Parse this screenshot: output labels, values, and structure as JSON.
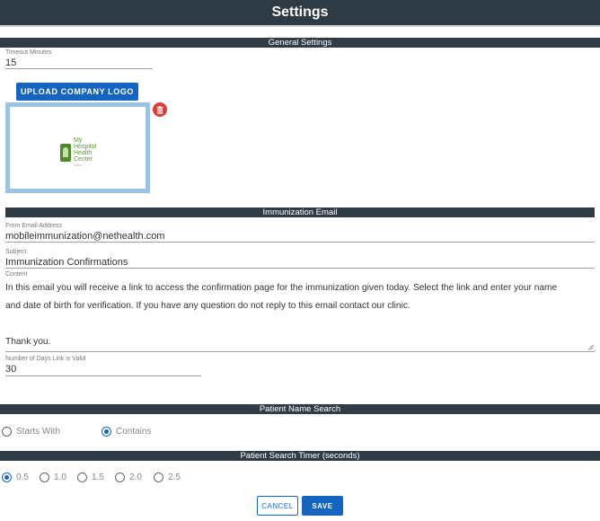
{
  "header": {
    "title": "Settings"
  },
  "general": {
    "section_title": "General Settings",
    "timeout_label": "Timeout Minutes",
    "timeout_value": "15",
    "upload_label": "UPLOAD COMPANY LOGO",
    "logo": {
      "line1": "My",
      "line2": "Hospital",
      "line3": "Health",
      "line4": "Center",
      "tagline": "Calico"
    }
  },
  "immunization_email": {
    "section_title": "Immunization Email",
    "from_label": "From Email Address",
    "from_value": "mobileimmunization@nethealth.com",
    "subject_label": "Subject",
    "subject_value": "Immunization Confirmations",
    "content_label": "Content",
    "content_line1": "In this email you will receive a link to access the confirmation page for the immunization given today. Select the link and enter your name",
    "content_line2": "and date of birth for verification. If you have any question do not reply to this email contact our clinic.",
    "content_line3": "Thank you.",
    "days_label": "Number of Days Link is Valid",
    "days_value": "30"
  },
  "patient_name_search": {
    "section_title": "Patient Name Search",
    "options": [
      "Starts With",
      "Contains"
    ],
    "selected": "Contains"
  },
  "patient_search_timer": {
    "section_title": "Patient Search Timer (seconds)",
    "options": [
      "0.5",
      "1.0",
      "1.5",
      "2.0",
      "2.5"
    ],
    "selected": "0.5"
  },
  "actions": {
    "cancel_label": "CANCEL",
    "save_label": "SAVE"
  },
  "colors": {
    "header_bg": "#2e3a44",
    "accent": "#1565c0",
    "delete": "#e53935",
    "logo_border": "#9cc3e6"
  }
}
